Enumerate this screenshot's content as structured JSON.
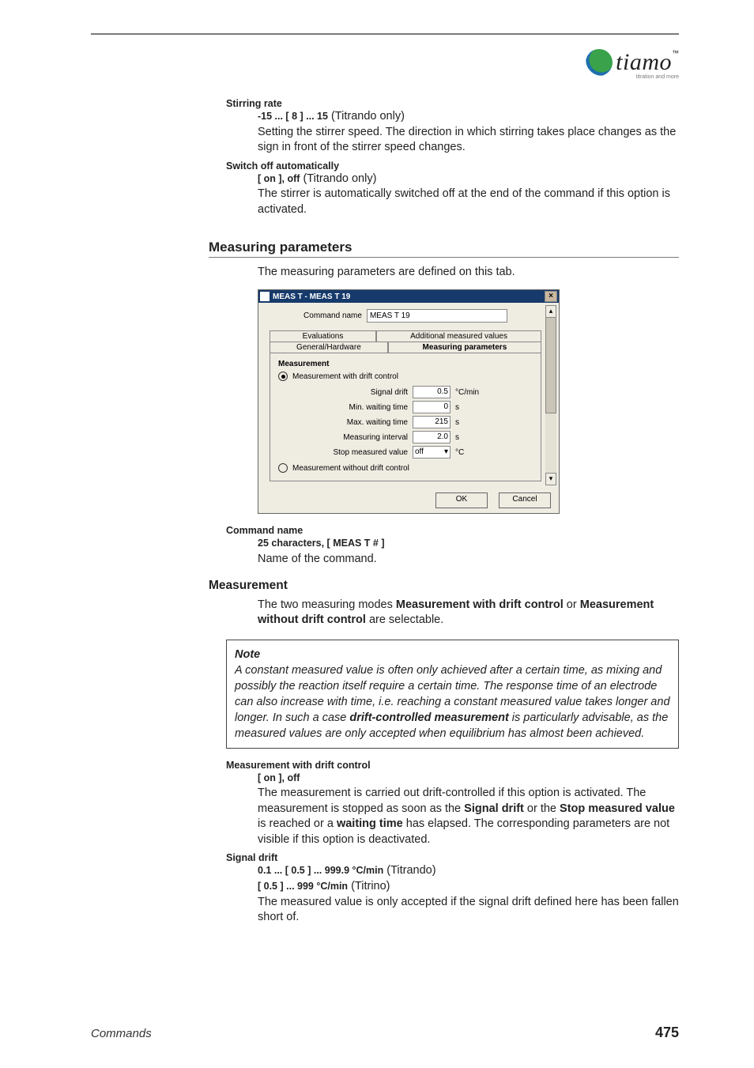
{
  "header": {
    "logo_text": "tiamo",
    "logo_tm": "™",
    "logo_sub": "titration and more"
  },
  "params": {
    "stirring_rate": {
      "name": "Stirring rate",
      "range": "-15 ... [ 8 ] ... 15",
      "annot": " (Titrando only)",
      "desc": "Setting the stirrer speed. The direction in which stirring takes place changes as the sign in front of the stirrer speed changes."
    },
    "switch_off": {
      "name": "Switch off automatically",
      "range": "[ on ], off",
      "annot": " (Titrando only)",
      "desc": "The stirrer is automatically switched off at the end of the command if this option is activated."
    },
    "command_name": {
      "name": "Command name",
      "range": "25 characters, [ MEAS T # ]",
      "desc": "Name of the command."
    },
    "meas_drift": {
      "name": "Measurement with drift control",
      "range": "[ on ], off",
      "desc1": "The measurement is carried out drift-controlled if this option is activated. The measurement is stopped as soon as the ",
      "b1": "Signal drift",
      "mid1": " or the ",
      "b2": "Stop measured value",
      "mid2": " is reached or a ",
      "b3": "waiting time",
      "end": " has elapsed. The corresponding parameters are not visible if this option is deactivated."
    },
    "signal_drift": {
      "name": "Signal drift",
      "range1": "0.1 ... [ 0.5 ] ... 999.9 °C/min",
      "annot1": " (Titrando)",
      "range2": "[ 0.5 ] ... 999 °C/min",
      "annot2": " (Titrino)",
      "desc": "The measured value is only accepted if the signal drift defined here has been fallen short of."
    }
  },
  "section": {
    "heading": "Measuring parameters",
    "intro": "The measuring parameters are defined on this tab.",
    "sub_heading": "Measurement",
    "para_pre": "The two measuring modes ",
    "para_b1": "Measurement with drift control",
    "para_mid": " or ",
    "para_b2": "Measurement without drift control",
    "para_post": " are selectable."
  },
  "note": {
    "head": "Note",
    "body_pre": "A constant measured value is often only achieved after a certain time, as mixing and possibly the reaction itself require a certain time. The response time of an electrode can also increase with time, i.e. reaching a constant measured value takes longer and longer. In such a case ",
    "body_bold": "drift-controlled measurement",
    "body_post": " is particularly advisable, as the measured values are only accepted when equilibrium has almost been achieved."
  },
  "dialog": {
    "title": "MEAS T - MEAS T 19",
    "close": "×",
    "scroll_up": "▴",
    "scroll_down": "▾",
    "cmd_label": "Command name",
    "cmd_value": "MEAS T 19",
    "tabs": {
      "evaluations": "Evaluations",
      "additional": "Additional measured values",
      "general": "General/Hardware",
      "measuring": "Measuring parameters"
    },
    "group": "Measurement",
    "radio1": "Measurement with drift control",
    "radio2": "Measurement without drift control",
    "rows": {
      "signal_drift": {
        "label": "Signal drift",
        "value": "0.5",
        "unit": "°C/min"
      },
      "min_wait": {
        "label": "Min. waiting time",
        "value": "0",
        "unit": "s"
      },
      "max_wait": {
        "label": "Max. waiting time",
        "value": "215",
        "unit": "s"
      },
      "interval": {
        "label": "Measuring interval",
        "value": "2.0",
        "unit": "s"
      },
      "stop": {
        "label": "Stop measured value",
        "value": "off",
        "unit": "°C",
        "caret": "▾"
      }
    },
    "ok": "OK",
    "cancel": "Cancel"
  },
  "footer": {
    "section": "Commands",
    "page": "475"
  }
}
